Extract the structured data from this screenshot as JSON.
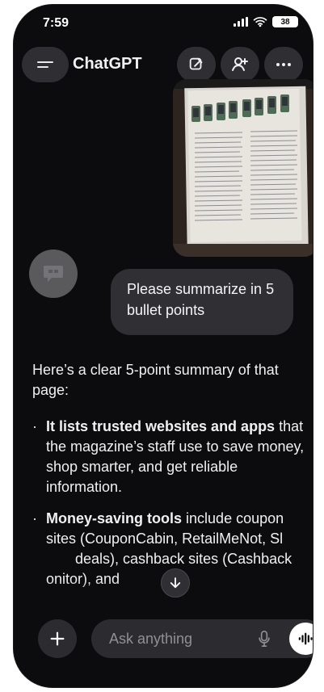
{
  "status_bar": {
    "time": "7:59",
    "battery": "38"
  },
  "header": {
    "title": "ChatGPT",
    "menu_icon": "hamburger-icon",
    "new_chat_icon": "pencil-square-icon",
    "add_person_icon": "person-plus-icon",
    "more_icon": "ellipsis-icon"
  },
  "conversation": {
    "uploaded_image_icon": "document-photo",
    "avatar_icon": "chat-bubble-icon",
    "user_message": "Please summarize in 5 bullet points",
    "assistant": {
      "intro": "Here’s a clear 5-point summary of that page:",
      "bullets": [
        {
          "bold": "It lists trusted websites and apps",
          "text": " that the magazine’s staff use to save money, shop smarter, and get reliable information."
        },
        {
          "bold": "Money-saving tools",
          "text": " include coupon sites (CouponCabin, RetailMeNot, Sl",
          "text_after_button": "deals), cashback sites (Cashback",
          "text_after_button_2": "onitor), and"
        }
      ]
    },
    "scroll_down_icon": "arrow-down-icon"
  },
  "composer": {
    "placeholder": "Ask anything",
    "plus_icon": "plus-icon",
    "mic_icon": "microphone-icon",
    "voice_icon": "voice-wave-icon"
  },
  "colors": {
    "background": "#0c0c0e",
    "surface": "#2f2f33",
    "text": "#f0f0f2",
    "muted": "#8f8f94",
    "accent_white": "#ffffff"
  }
}
